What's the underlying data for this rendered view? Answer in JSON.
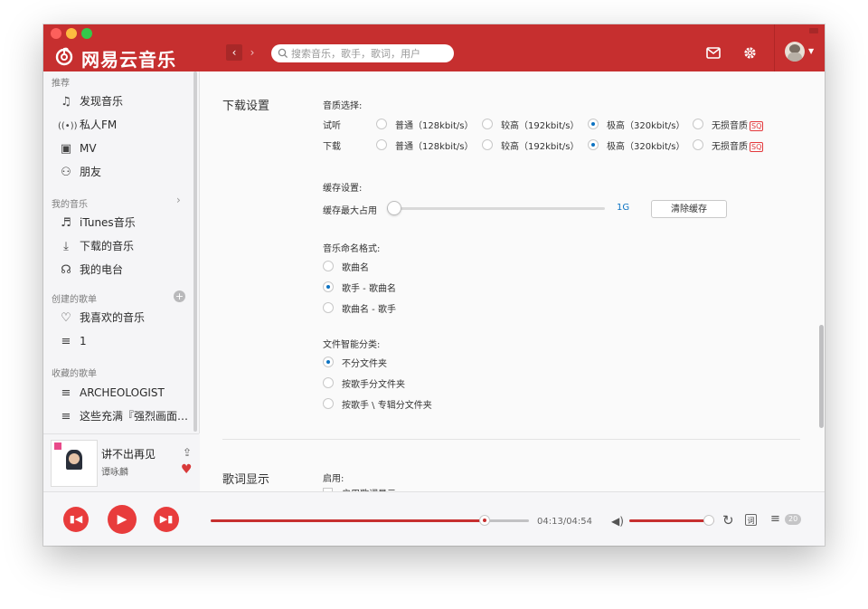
{
  "app": {
    "brand": "网易云音乐"
  },
  "search": {
    "placeholder": "搜索音乐，歌手，歌词，用户"
  },
  "sidebar": {
    "sections": [
      {
        "label": "推荐"
      },
      {
        "label": "我的音乐"
      },
      {
        "label": "创建的歌单"
      },
      {
        "label": "收藏的歌单"
      }
    ],
    "recommend": [
      {
        "label": "发现音乐",
        "icon": "music-note-icon"
      },
      {
        "label": "私人FM",
        "icon": "radio-waves-icon"
      },
      {
        "label": "MV",
        "icon": "video-icon"
      },
      {
        "label": "朋友",
        "icon": "friends-icon"
      }
    ],
    "mymusic": [
      {
        "label": "iTunes音乐",
        "icon": "itunes-icon"
      },
      {
        "label": "下载的音乐",
        "icon": "download-icon"
      },
      {
        "label": "我的电台",
        "icon": "podcast-icon"
      }
    ],
    "created": [
      {
        "label": "我喜欢的音乐",
        "icon": "heart-icon"
      },
      {
        "label": "1",
        "icon": "playlist-icon"
      }
    ],
    "collected": [
      {
        "label": "ARCHEOLOGIST",
        "icon": "playlist-icon"
      },
      {
        "label": "这些充满『强烈画面…",
        "icon": "playlist-icon"
      }
    ]
  },
  "now_playing": {
    "title": "讲不出再见",
    "artist": "谭咏麟"
  },
  "settings": {
    "download": {
      "section_title": "下载设置",
      "quality_label": "音质选择:",
      "rows": [
        {
          "label": "试听",
          "selected": 2
        },
        {
          "label": "下载",
          "selected": 2
        }
      ],
      "options": [
        "普通（128kbit/s）",
        "较高（192kbit/s）",
        "极高（320kbit/s）",
        "无损音质"
      ],
      "sq_badge": "SQ",
      "cache_label": "缓存设置:",
      "cache_max_label": "缓存最大占用",
      "cache_value": "1G",
      "cache_fraction": 0.03,
      "clear_cache_button": "清除缓存",
      "naming_label": "音乐命名格式:",
      "naming_options": [
        "歌曲名",
        "歌手 - 歌曲名",
        "歌曲名 - 歌手"
      ],
      "naming_selected": 1,
      "folder_label": "文件智能分类:",
      "folder_options": [
        "不分文件夹",
        "按歌手分文件夹",
        "按歌手 \\ 专辑分文件夹"
      ],
      "folder_selected": 0
    },
    "lyrics": {
      "section_title": "歌词显示",
      "enable_label": "启用:",
      "enable_checkbox": "启用歌词显示"
    }
  },
  "player": {
    "time": "04:13/04:54",
    "progress": 0.86,
    "volume": 1.0,
    "playlist_count": "20",
    "lyric_button": "词",
    "accent": "#c62f2f"
  }
}
